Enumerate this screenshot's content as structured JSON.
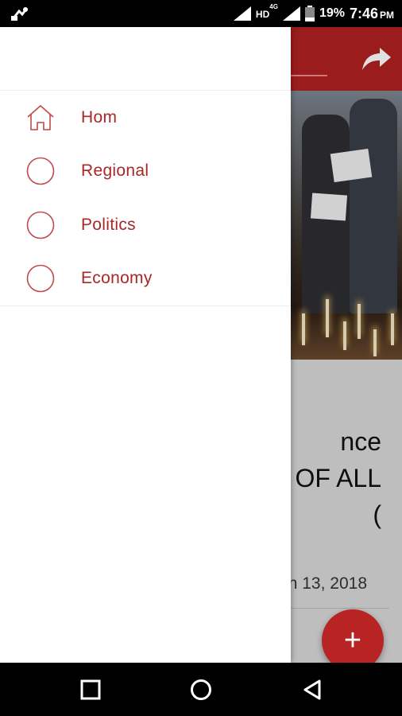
{
  "status_bar": {
    "network_label": "HD",
    "network_sup": "4G",
    "battery": "19%",
    "time": "7:46",
    "ampm": "PM"
  },
  "drawer": {
    "items": [
      {
        "label": "Hom",
        "icon": "home-icon"
      },
      {
        "label": "Regional",
        "icon": "circle-icon"
      },
      {
        "label": "Politics",
        "icon": "circle-icon"
      },
      {
        "label": "Economy",
        "icon": "circle-icon"
      }
    ]
  },
  "background": {
    "headline_line1": "nce",
    "headline_line2": "T OF ALL",
    "headline_line3": "(",
    "date": "n 13, 2018",
    "fab_label": "+"
  },
  "colors": {
    "accent": "#b02020",
    "menu_text": "#a82727"
  }
}
